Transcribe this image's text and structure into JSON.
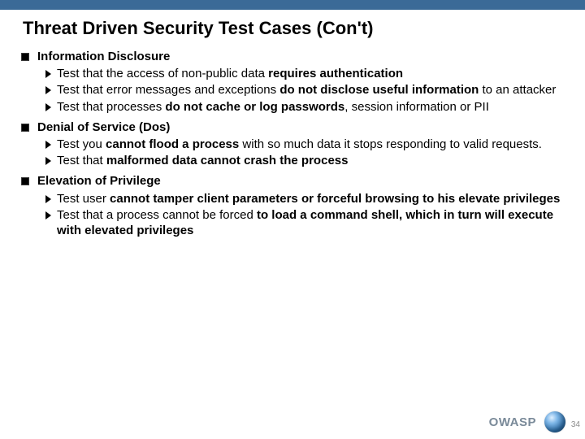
{
  "title": "Threat Driven Security Test Cases (Con't)",
  "sections": [
    {
      "heading": "Information Disclosure",
      "items": [
        {
          "pre": "Test that the access of non-public data ",
          "bold": "requires authentication",
          "post": ""
        },
        {
          "pre": "Test that error messages and exceptions ",
          "bold": "do not disclose useful information",
          "post": " to an attacker"
        },
        {
          "pre": "Test that processes ",
          "bold": "do not cache or log passwords",
          "post": ", session information or PII"
        }
      ]
    },
    {
      "heading": "Denial of Service (Dos)",
      "items": [
        {
          "pre": "Test you ",
          "bold": "cannot flood a process",
          "post": " with so much data it stops responding to valid requests."
        },
        {
          "pre": "Test that ",
          "bold": "malformed data cannot crash the process",
          "post": ""
        }
      ]
    },
    {
      "heading": "Elevation of Privilege",
      "items": [
        {
          "pre": "Test user ",
          "bold": "cannot tamper client parameters or forceful browsing to his elevate privileges",
          "post": ""
        },
        {
          "pre": "Test that a process cannot be forced ",
          "bold": "to load a command shell, which in turn will execute with elevated privileges",
          "post": ""
        }
      ]
    }
  ],
  "footer": {
    "org": "OWASP"
  },
  "page_number": "34"
}
